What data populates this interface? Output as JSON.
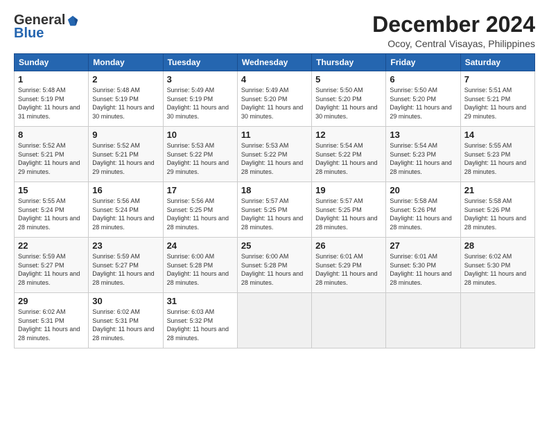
{
  "header": {
    "logo_general": "General",
    "logo_blue": "Blue",
    "month_title": "December 2024",
    "location": "Ocoy, Central Visayas, Philippines"
  },
  "days_of_week": [
    "Sunday",
    "Monday",
    "Tuesday",
    "Wednesday",
    "Thursday",
    "Friday",
    "Saturday"
  ],
  "weeks": [
    [
      {
        "day": "1",
        "sunrise": "5:48 AM",
        "sunset": "5:19 PM",
        "daylight": "11 hours and 31 minutes."
      },
      {
        "day": "2",
        "sunrise": "5:48 AM",
        "sunset": "5:19 PM",
        "daylight": "11 hours and 30 minutes."
      },
      {
        "day": "3",
        "sunrise": "5:49 AM",
        "sunset": "5:19 PM",
        "daylight": "11 hours and 30 minutes."
      },
      {
        "day": "4",
        "sunrise": "5:49 AM",
        "sunset": "5:20 PM",
        "daylight": "11 hours and 30 minutes."
      },
      {
        "day": "5",
        "sunrise": "5:50 AM",
        "sunset": "5:20 PM",
        "daylight": "11 hours and 30 minutes."
      },
      {
        "day": "6",
        "sunrise": "5:50 AM",
        "sunset": "5:20 PM",
        "daylight": "11 hours and 29 minutes."
      },
      {
        "day": "7",
        "sunrise": "5:51 AM",
        "sunset": "5:21 PM",
        "daylight": "11 hours and 29 minutes."
      }
    ],
    [
      {
        "day": "8",
        "sunrise": "5:52 AM",
        "sunset": "5:21 PM",
        "daylight": "11 hours and 29 minutes."
      },
      {
        "day": "9",
        "sunrise": "5:52 AM",
        "sunset": "5:21 PM",
        "daylight": "11 hours and 29 minutes."
      },
      {
        "day": "10",
        "sunrise": "5:53 AM",
        "sunset": "5:22 PM",
        "daylight": "11 hours and 29 minutes."
      },
      {
        "day": "11",
        "sunrise": "5:53 AM",
        "sunset": "5:22 PM",
        "daylight": "11 hours and 28 minutes."
      },
      {
        "day": "12",
        "sunrise": "5:54 AM",
        "sunset": "5:22 PM",
        "daylight": "11 hours and 28 minutes."
      },
      {
        "day": "13",
        "sunrise": "5:54 AM",
        "sunset": "5:23 PM",
        "daylight": "11 hours and 28 minutes."
      },
      {
        "day": "14",
        "sunrise": "5:55 AM",
        "sunset": "5:23 PM",
        "daylight": "11 hours and 28 minutes."
      }
    ],
    [
      {
        "day": "15",
        "sunrise": "5:55 AM",
        "sunset": "5:24 PM",
        "daylight": "11 hours and 28 minutes."
      },
      {
        "day": "16",
        "sunrise": "5:56 AM",
        "sunset": "5:24 PM",
        "daylight": "11 hours and 28 minutes."
      },
      {
        "day": "17",
        "sunrise": "5:56 AM",
        "sunset": "5:25 PM",
        "daylight": "11 hours and 28 minutes."
      },
      {
        "day": "18",
        "sunrise": "5:57 AM",
        "sunset": "5:25 PM",
        "daylight": "11 hours and 28 minutes."
      },
      {
        "day": "19",
        "sunrise": "5:57 AM",
        "sunset": "5:25 PM",
        "daylight": "11 hours and 28 minutes."
      },
      {
        "day": "20",
        "sunrise": "5:58 AM",
        "sunset": "5:26 PM",
        "daylight": "11 hours and 28 minutes."
      },
      {
        "day": "21",
        "sunrise": "5:58 AM",
        "sunset": "5:26 PM",
        "daylight": "11 hours and 28 minutes."
      }
    ],
    [
      {
        "day": "22",
        "sunrise": "5:59 AM",
        "sunset": "5:27 PM",
        "daylight": "11 hours and 28 minutes."
      },
      {
        "day": "23",
        "sunrise": "5:59 AM",
        "sunset": "5:27 PM",
        "daylight": "11 hours and 28 minutes."
      },
      {
        "day": "24",
        "sunrise": "6:00 AM",
        "sunset": "5:28 PM",
        "daylight": "11 hours and 28 minutes."
      },
      {
        "day": "25",
        "sunrise": "6:00 AM",
        "sunset": "5:28 PM",
        "daylight": "11 hours and 28 minutes."
      },
      {
        "day": "26",
        "sunrise": "6:01 AM",
        "sunset": "5:29 PM",
        "daylight": "11 hours and 28 minutes."
      },
      {
        "day": "27",
        "sunrise": "6:01 AM",
        "sunset": "5:30 PM",
        "daylight": "11 hours and 28 minutes."
      },
      {
        "day": "28",
        "sunrise": "6:02 AM",
        "sunset": "5:30 PM",
        "daylight": "11 hours and 28 minutes."
      }
    ],
    [
      {
        "day": "29",
        "sunrise": "6:02 AM",
        "sunset": "5:31 PM",
        "daylight": "11 hours and 28 minutes."
      },
      {
        "day": "30",
        "sunrise": "6:02 AM",
        "sunset": "5:31 PM",
        "daylight": "11 hours and 28 minutes."
      },
      {
        "day": "31",
        "sunrise": "6:03 AM",
        "sunset": "5:32 PM",
        "daylight": "11 hours and 28 minutes."
      },
      null,
      null,
      null,
      null
    ]
  ]
}
